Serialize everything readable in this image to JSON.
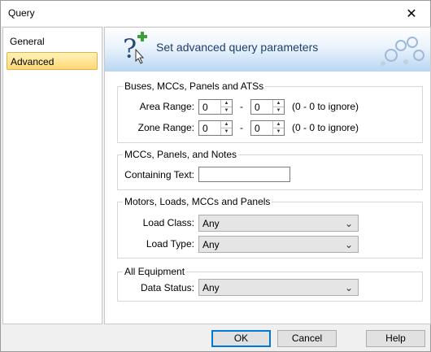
{
  "window": {
    "title": "Query"
  },
  "sidebar": {
    "items": [
      {
        "label": "General"
      },
      {
        "label": "Advanced"
      }
    ]
  },
  "banner": {
    "title": "Set advanced query parameters"
  },
  "groups": {
    "buses": {
      "title": "Buses, MCCs, Panels and ATSs",
      "area_label": "Area Range:",
      "area_from": "0",
      "area_to": "0",
      "area_hint": "(0 - 0 to ignore)",
      "zone_label": "Zone Range:",
      "zone_from": "0",
      "zone_to": "0",
      "zone_hint": "(0 - 0 to ignore)",
      "dash": "-"
    },
    "mccs": {
      "title": "MCCs, Panels, and Notes",
      "text_label": "Containing Text:",
      "text_value": ""
    },
    "motors": {
      "title": "Motors, Loads, MCCs and Panels",
      "class_label": "Load Class:",
      "class_value": "Any",
      "type_label": "Load Type:",
      "type_value": "Any"
    },
    "all": {
      "title": "All Equipment",
      "status_label": "Data Status:",
      "status_value": "Any"
    }
  },
  "buttons": {
    "ok": "OK",
    "cancel": "Cancel",
    "help": "Help"
  },
  "icons": {
    "close": "close-icon",
    "question": "question-plus-icon",
    "gears": "gears-icon",
    "dropdown": "chevron-down-icon"
  },
  "colors": {
    "banner_title": "#1f3d6b",
    "selected": "#ffd877",
    "default_button_border": "#0078d7"
  }
}
